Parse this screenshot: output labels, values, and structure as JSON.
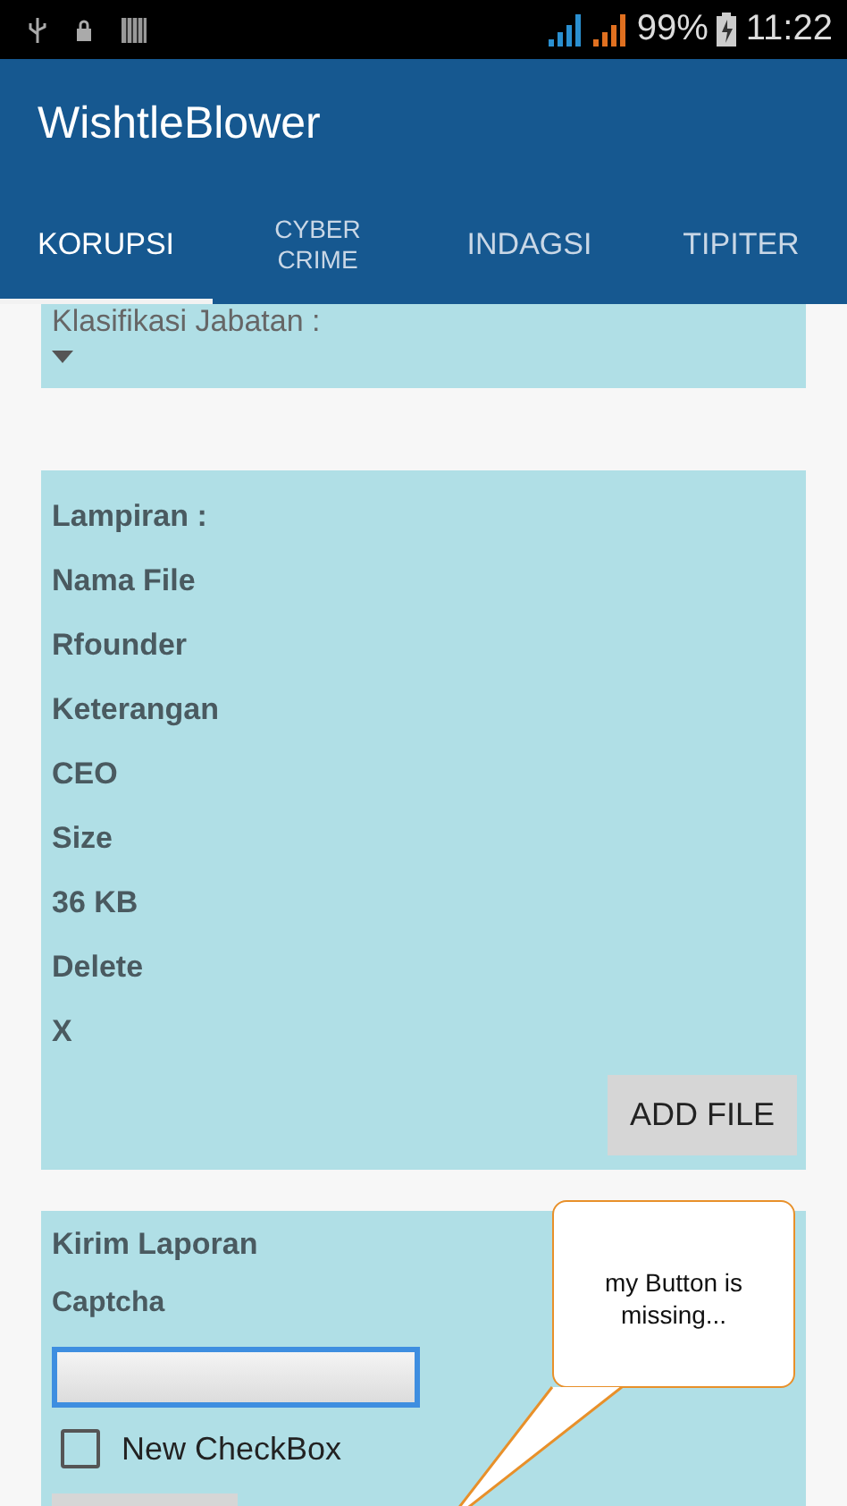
{
  "status_bar": {
    "battery": "99%",
    "time": "11:22"
  },
  "app_bar": {
    "title": "WishtleBlower"
  },
  "tabs": [
    {
      "label": "KORUPSI",
      "selected": true,
      "kind": "single"
    },
    {
      "label": "CYBER CRIME",
      "selected": false,
      "kind": "double"
    },
    {
      "label": "INDAGSI",
      "selected": false,
      "kind": "single"
    },
    {
      "label": "TIPITER",
      "selected": false,
      "kind": "single"
    }
  ],
  "classification": {
    "label": "Klasifikasi Jabatan :"
  },
  "attachment": {
    "title": "Lampiran :",
    "lines": [
      "Nama File",
      "Rfounder",
      "Keterangan",
      "CEO",
      "Size",
      "36 KB",
      "Delete",
      "X"
    ],
    "button": "ADD FILE"
  },
  "report": {
    "title": "Kirim Laporan",
    "captcha_label": "Captcha",
    "checkbox": {
      "label": "New CheckBox",
      "checked": false
    }
  },
  "callout": {
    "text": "my Button is missing..."
  }
}
